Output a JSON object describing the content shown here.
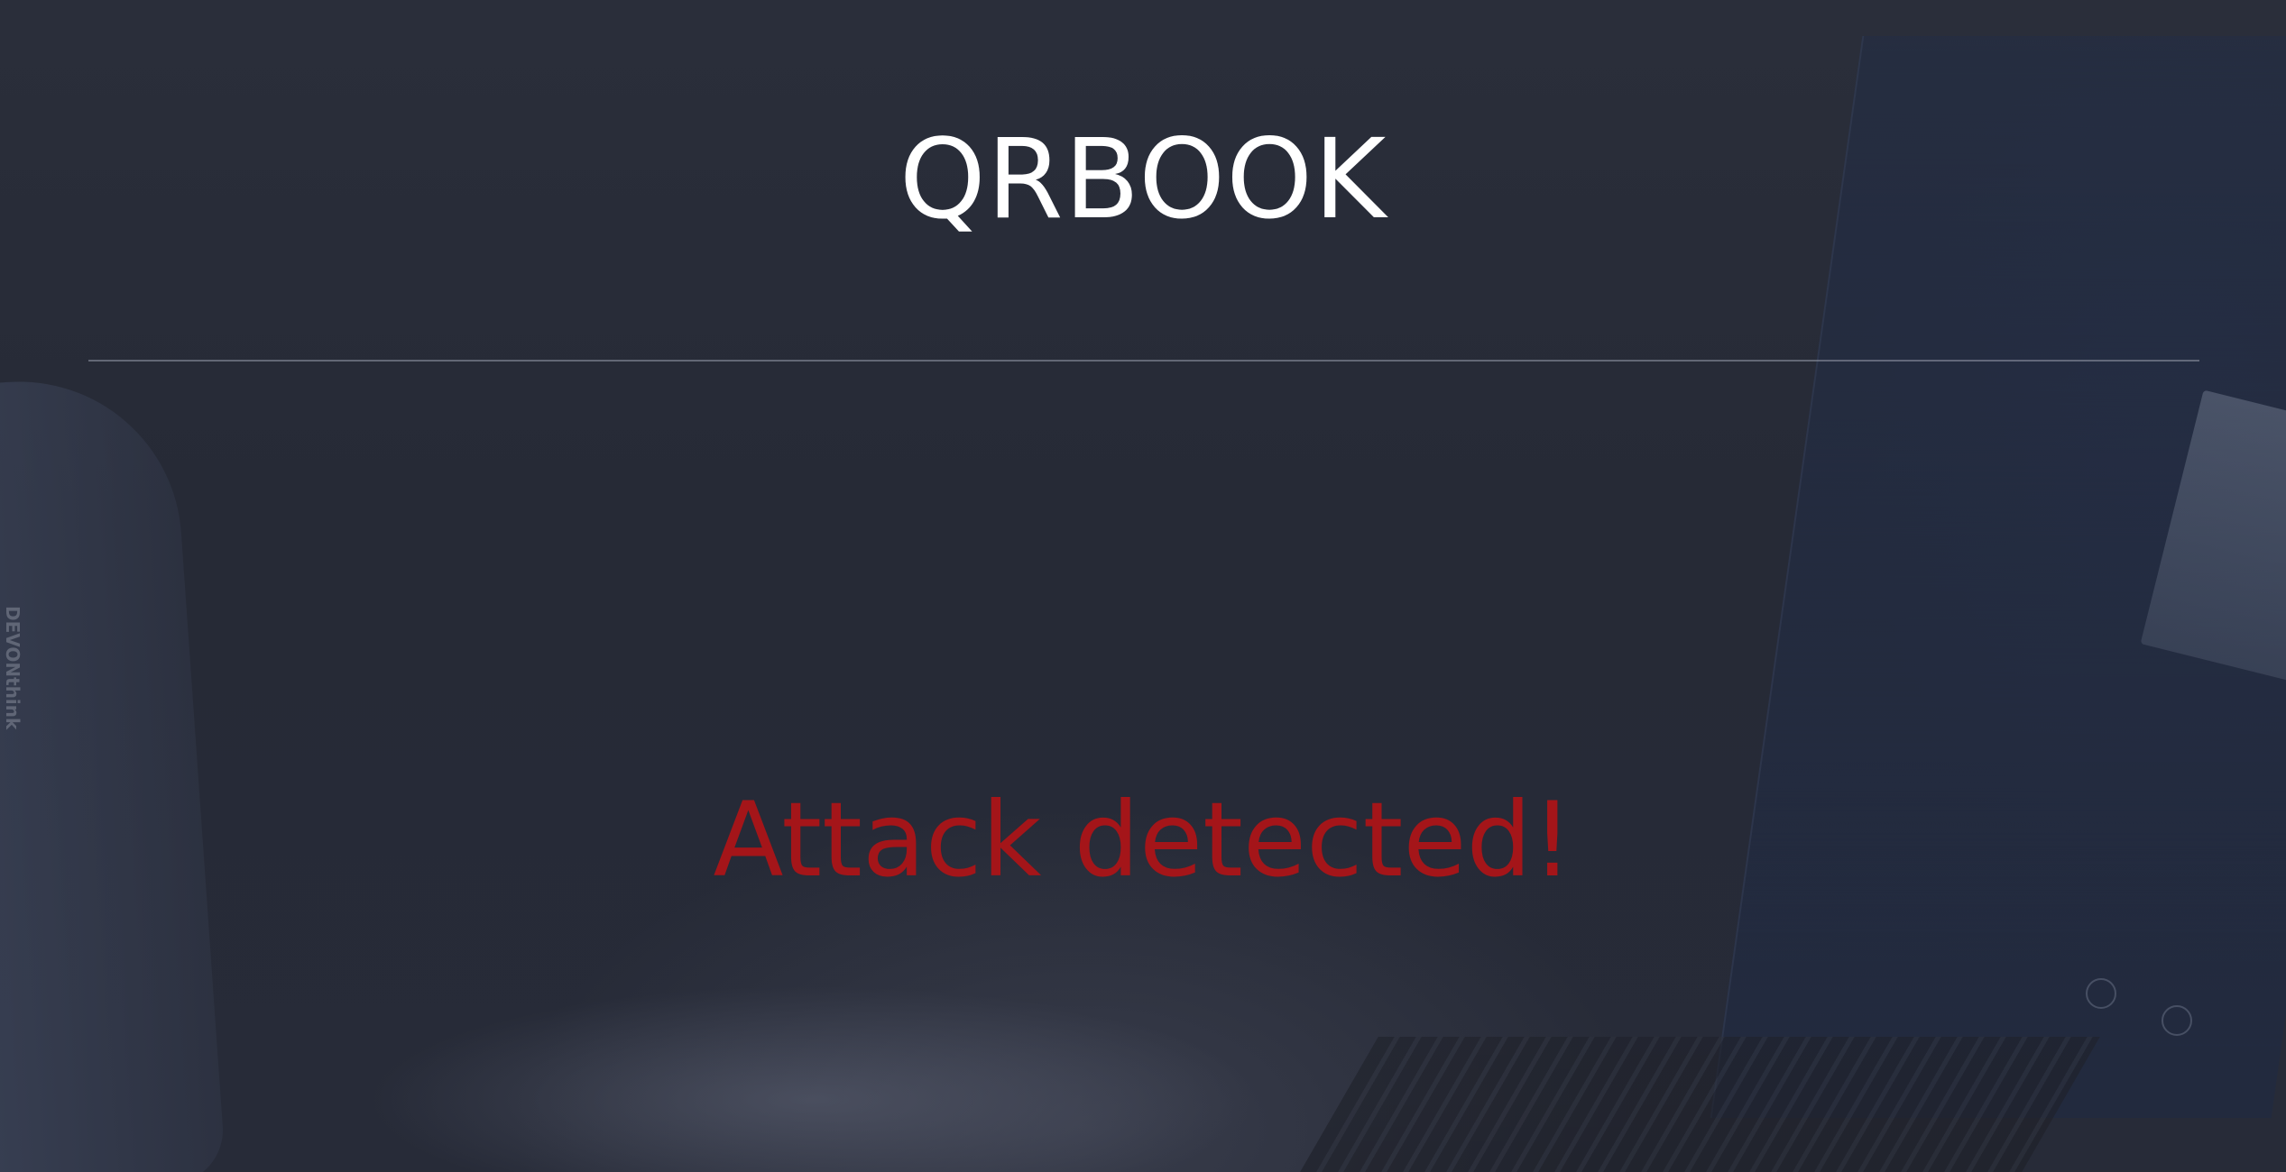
{
  "header": {
    "title": "QRBOOK"
  },
  "main": {
    "alert_message": "Attack detected!",
    "alert_color": "#a41519"
  },
  "background": {
    "watermark_text": "DEVONthink",
    "base_color": "#272b37"
  }
}
